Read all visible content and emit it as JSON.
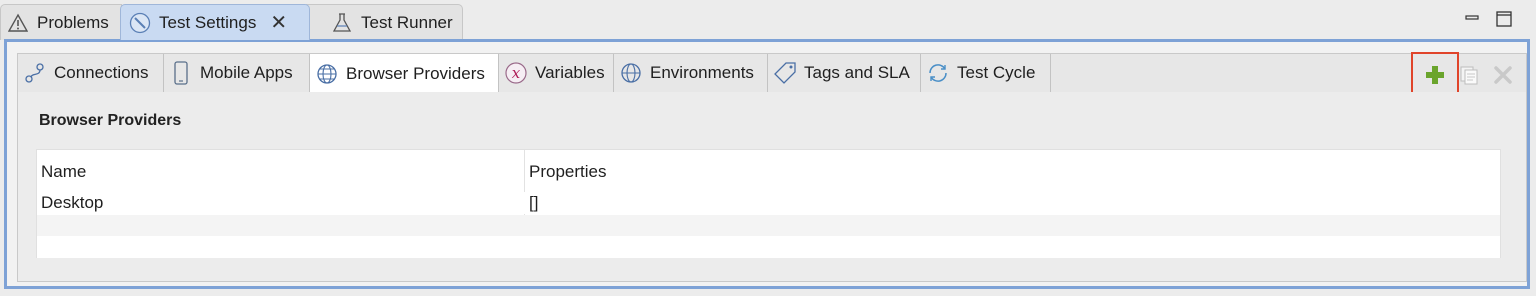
{
  "editor_tabs": [
    {
      "label": "Problems",
      "icon": "warning-icon"
    },
    {
      "label": "Test Settings",
      "icon": "wrench-icon",
      "active": true,
      "closable": true
    },
    {
      "label": "Test Runner",
      "icon": "flask-icon"
    }
  ],
  "window_controls": {
    "minimize": "minimize-icon",
    "maximize": "maximize-icon"
  },
  "settings_tabs": [
    {
      "label": "Connections",
      "icon": "connections-icon"
    },
    {
      "label": "Mobile Apps",
      "icon": "phone-icon"
    },
    {
      "label": "Browser Providers",
      "icon": "globe-icon",
      "active": true
    },
    {
      "label": "Variables",
      "icon": "variable-icon"
    },
    {
      "label": "Environments",
      "icon": "globe-icon"
    },
    {
      "label": "Tags and SLA",
      "icon": "tag-icon"
    },
    {
      "label": "Test Cycle",
      "icon": "cycle-icon"
    }
  ],
  "toolbar": {
    "add_icon": "plus-icon",
    "copy_icon": "copy-icon",
    "delete_icon": "delete-icon",
    "highlight_color": "#e0442a"
  },
  "section": {
    "title": "Browser Providers"
  },
  "table": {
    "columns": [
      "Name",
      "Properties"
    ],
    "rows": [
      [
        "Desktop",
        "[]"
      ],
      [
        "",
        ""
      ],
      [
        "",
        ""
      ]
    ]
  },
  "colors": {
    "accent": "#7ea2d6",
    "active_tab": "#c9daf2",
    "add_green": "#6aa42c"
  }
}
